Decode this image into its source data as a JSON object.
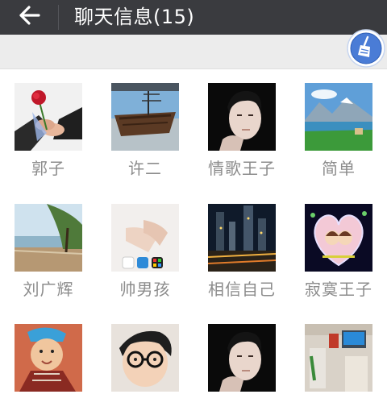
{
  "header": {
    "title": "聊天信息(15)",
    "back_icon": "arrow-left-icon"
  },
  "toolbar": {
    "clean_icon": "broom-icon",
    "accent_color": "#4a7cd6"
  },
  "members": [
    {
      "name": "郭子",
      "avatar": "holding-hands-with-rose"
    },
    {
      "name": "许二",
      "avatar": "wooden-ship"
    },
    {
      "name": "情歌王子",
      "avatar": "young-man-portrait"
    },
    {
      "name": "简单",
      "avatar": "mountain-lake-landscape"
    },
    {
      "name": "刘广辉",
      "avatar": "lakeside-tree"
    },
    {
      "name": "帅男孩",
      "avatar": "hands-and-app-icons"
    },
    {
      "name": "相信自己",
      "avatar": "night-city-skyline"
    },
    {
      "name": "寂寞王子",
      "avatar": "heart-frame-couple"
    },
    {
      "name": "",
      "avatar": "boy-with-cap"
    },
    {
      "name": "",
      "avatar": "child-with-glasses"
    },
    {
      "name": "",
      "avatar": "young-man-portrait"
    },
    {
      "name": "",
      "avatar": "shop-interior"
    }
  ]
}
